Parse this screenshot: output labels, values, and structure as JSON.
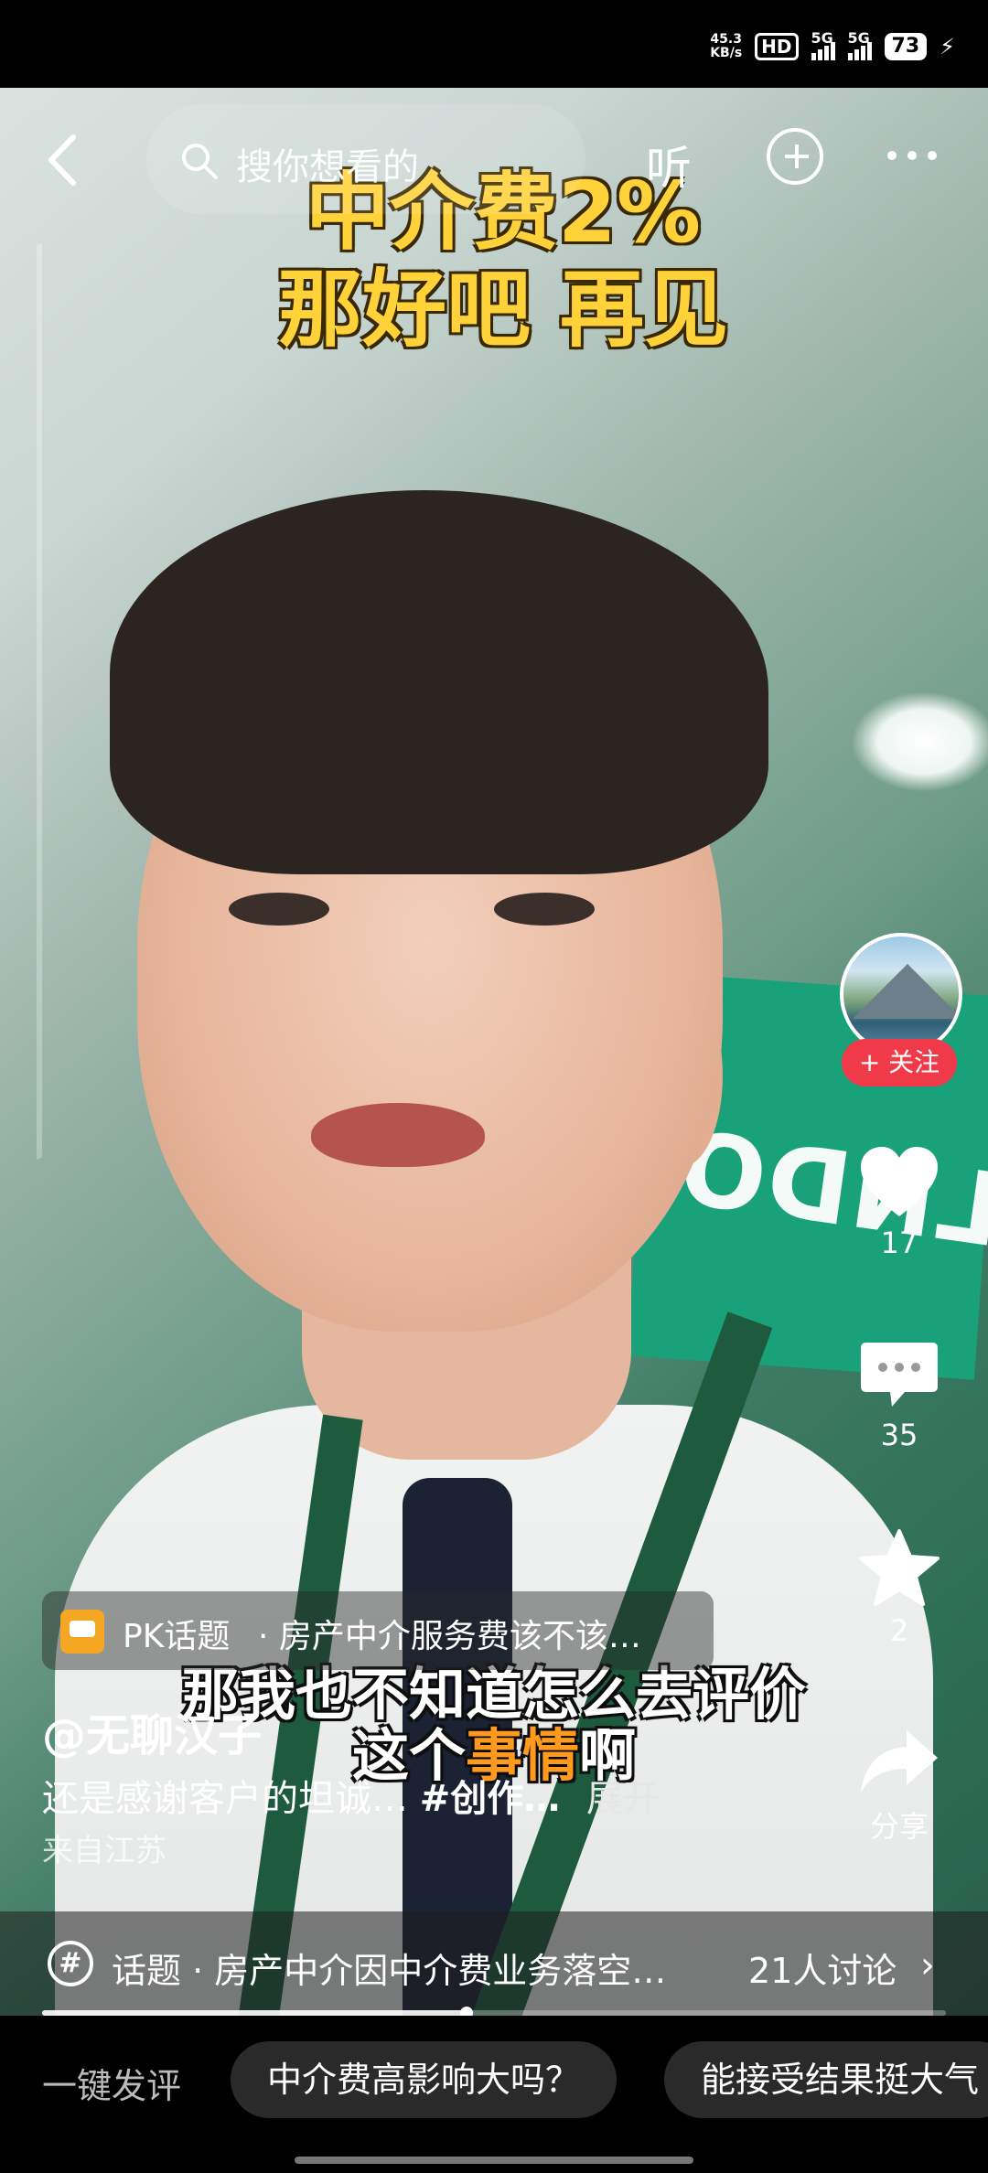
{
  "status_bar": {
    "net_speed_value": "45.3",
    "net_speed_unit": "KB/s",
    "hd_label": "HD",
    "signal1_label": "5G",
    "signal2_label": "5G",
    "battery": "73"
  },
  "top_bar": {
    "search_placeholder": "搜你想看的",
    "listen_label": "听"
  },
  "video": {
    "title_line1": "中介费2%",
    "title_line2": "那好吧  再见",
    "subtitle_line1": "那我也不知道怎么去评价",
    "subtitle_line2_a": "这个",
    "subtitle_line2_b": "事情",
    "subtitle_line2_c": "啊",
    "sign_text": "DILNDO"
  },
  "actions": {
    "follow_label": "+ 关注",
    "likes": "17",
    "comments": "35",
    "favorites": "2",
    "share_label": "分享"
  },
  "info": {
    "pk_title": "PK话题",
    "pk_text": "·  房产中介服务费该不该…",
    "author": "@无聊汉子",
    "description": "还是感谢客户的坦诚…",
    "hashtag": "#创作…",
    "expand_label": "展开",
    "location": "来自江苏"
  },
  "topic": {
    "text": "话题 · 房产中介因中介费业务落空…",
    "count": "21人讨论"
  },
  "progress": {
    "value": 0.47
  },
  "comment_bar": {
    "quick_label": "一键发评",
    "chip1": "中介费高影响大吗？",
    "chip2": "能接受结果挺大气"
  }
}
